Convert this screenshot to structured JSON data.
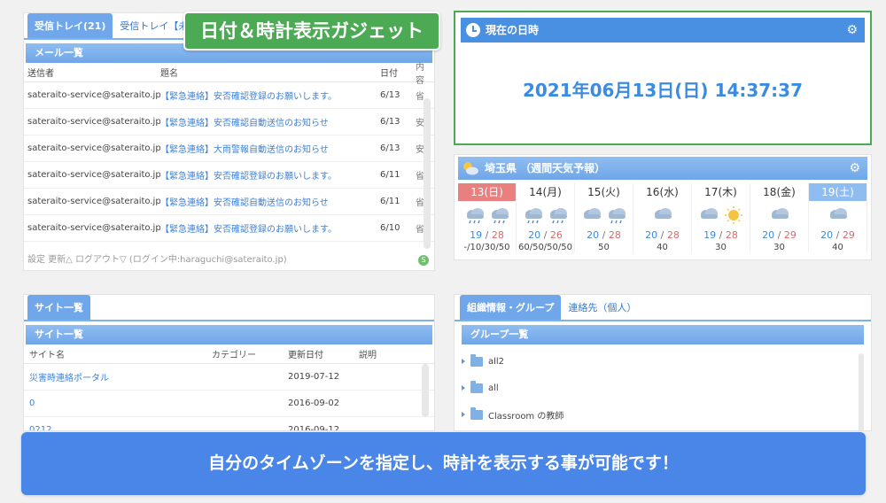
{
  "gadget_label": "日付＆時計表示ガジェット",
  "banner": "自分のタイムゾーンを指定し、時計を表示する事が可能です！",
  "mail": {
    "tabs": [
      "受信トレイ(21)",
      "受信トレイ【未読】"
    ],
    "section_title": "メール一覧",
    "columns": {
      "from": "送信者",
      "subject": "題名",
      "date": "日付",
      "extra": "内容"
    },
    "rows": [
      {
        "from": "sateraito-service@sateraito.jp",
        "subject": "【緊急連絡】安否確認登録のお願いします。",
        "date": "6/13",
        "x": "省"
      },
      {
        "from": "sateraito-service@sateraito.jp",
        "subject": "【緊急連絡】安否確認自動送信のお知らせ",
        "date": "6/13",
        "x": "安"
      },
      {
        "from": "sateraito-service@sateraito.jp",
        "subject": "【緊急連絡】大雨警報自動送信のお知らせ",
        "date": "6/13",
        "x": "安"
      },
      {
        "from": "sateraito-service@sateraito.jp",
        "subject": "【緊急連絡】安否確認登録のお願いします。",
        "date": "6/11",
        "x": "省"
      },
      {
        "from": "sateraito-service@sateraito.jp",
        "subject": "【緊急連絡】安否確認自動送信のお知らせ",
        "date": "6/11",
        "x": "省"
      },
      {
        "from": "sateraito-service@sateraito.jp",
        "subject": "【緊急連絡】安否確認登録のお願いします。",
        "date": "6/10",
        "x": "省"
      }
    ],
    "footer": "設定  更新△    ログアウト▽  (ログイン中:haraguchi@sateraito.jp)",
    "sync_label": "S"
  },
  "clock": {
    "title": "現在の日時",
    "datetime": "2021年06月13日(日)  14:37:37"
  },
  "weather": {
    "title": "埼玉県  （週間天気予報）",
    "days": [
      {
        "label": "13(日)",
        "type": "sun",
        "icons": [
          "cloud-rain-icon",
          "cloud-rain-icon"
        ],
        "min": "19",
        "max": "28",
        "pop": "-/10/30/50"
      },
      {
        "label": "14(月)",
        "type": "",
        "icons": [
          "cloud-rain-icon",
          "cloud-rain-icon"
        ],
        "min": "20",
        "max": "26",
        "pop": "60/50/50/50"
      },
      {
        "label": "15(火)",
        "type": "",
        "icons": [
          "cloud-icon",
          "cloud-rain-icon"
        ],
        "min": "20",
        "max": "28",
        "pop": "50"
      },
      {
        "label": "16(水)",
        "type": "",
        "icons": [
          "cloud-icon"
        ],
        "min": "20",
        "max": "28",
        "pop": "40"
      },
      {
        "label": "17(木)",
        "type": "",
        "icons": [
          "cloud-icon",
          "sun-icon"
        ],
        "min": "19",
        "max": "28",
        "pop": "30"
      },
      {
        "label": "18(金)",
        "type": "",
        "icons": [
          "cloud-icon"
        ],
        "min": "20",
        "max": "29",
        "pop": "30"
      },
      {
        "label": "19(土)",
        "type": "sat",
        "icons": [
          "cloud-icon"
        ],
        "min": "20",
        "max": "29",
        "pop": "40"
      }
    ]
  },
  "sites": {
    "tab": "サイト一覧",
    "section_title": "サイト一覧",
    "columns": {
      "name": "サイト名",
      "category": "カテゴリー",
      "updated": "更新日付",
      "desc": "説明"
    },
    "rows": [
      {
        "name": "災害時連絡ポータル",
        "category": "",
        "updated": "2019-07-12",
        "desc": ""
      },
      {
        "name": "0",
        "category": "",
        "updated": "2016-09-02",
        "desc": ""
      },
      {
        "name": "0212",
        "category": "",
        "updated": "2016-09-12",
        "desc": ""
      }
    ]
  },
  "org": {
    "tabs": [
      "組織情報・グループ",
      "連絡先（個人）"
    ],
    "section_title": "グループ一覧",
    "groups": [
      "all2",
      "all",
      "Classroom の教師"
    ]
  },
  "colors": {
    "accent": "#4a90e2",
    "green": "#4caa55",
    "banner": "#4a86e8"
  }
}
